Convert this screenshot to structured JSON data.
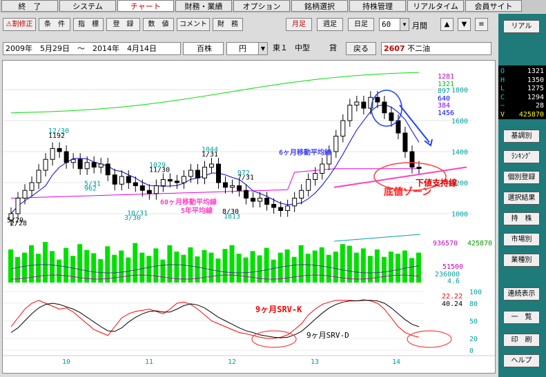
{
  "menu": {
    "tabs": [
      "終　了",
      "システム",
      "チャート",
      "財務・業績",
      "オプション",
      "銘柄選択",
      "持株管理",
      "リアルタイム",
      "会員サイト"
    ],
    "active": "チャート"
  },
  "toolbar": {
    "buttons": [
      "⚠割修正",
      "条　件",
      "指　標",
      "登　録",
      "数　値",
      "コメント",
      "財　務"
    ],
    "periods": [
      "月足",
      "週足",
      "日足"
    ],
    "count_value": "60",
    "unit_label": "月間",
    "nav_up": "▲",
    "nav_down": "▼",
    "menu_icon": "≡",
    "real_label": "リアル"
  },
  "info": {
    "date_range": "2009年　5月29日　～　2014年　4月14日",
    "unit": "百株",
    "currency": "円",
    "exchange": "東１",
    "size": "中型",
    "lend": "貸",
    "back_label": "戻る",
    "code": "2607",
    "name": "不二油"
  },
  "ohlc_panel": {
    "rows": [
      {
        "k": "O",
        "v": "1321"
      },
      {
        "k": "H",
        "v": "1350"
      },
      {
        "k": "L",
        "v": "1275"
      },
      {
        "k": "C",
        "v": "1294"
      },
      {
        "k": "−",
        "v": "28"
      },
      {
        "k": "V",
        "v": "425870"
      }
    ]
  },
  "side_buttons": [
    "基調別",
    "ﾗﾝｷﾝｸﾞ",
    "個別登録",
    "選択結果",
    "持　株",
    "市場別",
    "業種別",
    "連続表示",
    "一　覧",
    "印　刷",
    "ヘルプ"
  ],
  "chart_data": [
    {
      "type": "candlestick",
      "price_axis": [
        "1800",
        "1600",
        "1400",
        "1200",
        "1000"
      ],
      "ylim": [
        800,
        1900
      ],
      "x_labels": [
        "10",
        "11",
        "12",
        "13",
        "14"
      ],
      "legend_values": [
        {
          "text": "1281",
          "color": "#c000c0"
        },
        {
          "text": "1321",
          "color": "#00c000"
        },
        {
          "text": "897",
          "color": "#00a0a0"
        },
        {
          "text": "640",
          "color": "#0000ff"
        },
        {
          "text": "384",
          "color": "#8000ff"
        },
        {
          "text": "1456",
          "color": "#0000ff"
        }
      ],
      "closes": [
        1000,
        1100,
        1150,
        1200,
        1280,
        1350,
        1420,
        1400,
        1330,
        1350,
        1290,
        1330,
        1300,
        1320,
        1250,
        1190,
        1240,
        1200,
        1180,
        1150,
        1130,
        1180,
        1220,
        1210,
        1200,
        1240,
        1280,
        1230,
        1300,
        1320,
        1200,
        1170,
        1180,
        1150,
        1100,
        1080,
        1100,
        1060,
        1040,
        1020,
        1050,
        1100,
        1150,
        1220,
        1260,
        1320,
        1400,
        1500,
        1600,
        1700,
        1720,
        1680,
        1750,
        1720,
        1650,
        1600,
        1520,
        1400,
        1300,
        1294
      ],
      "annotations": [
        {
          "text": "12/30",
          "value": 1486
        },
        {
          "text": "1192",
          "value": 1192
        },
        {
          "text": "5/31",
          "value": 1192
        },
        {
          "text": "962",
          "value": 962
        },
        {
          "text": "5/29",
          "value": 962
        },
        {
          "text": "2/28",
          "value": 1245
        },
        {
          "text": "1029",
          "value": 1029
        },
        {
          "text": "11/30",
          "value": 1029
        },
        {
          "text": "10/31",
          "value": 1336
        },
        {
          "text": "3/30",
          "value": 1187
        },
        {
          "text": "1044",
          "value": 1044
        },
        {
          "text": "1/31",
          "value": 1044
        },
        {
          "text": "972",
          "value": 972
        },
        {
          "text": "7/31",
          "value": 972
        },
        {
          "text": "8/30",
          "value": 1813
        },
        {
          "text": "1813",
          "value": 1813
        }
      ],
      "texts": {
        "ma6": "6ヶ月移動平均線",
        "ma60": "60ヶ月移動平均線",
        "ma5y": "5年平均線",
        "support": "下値支持線",
        "bottom": "底値ゾーン"
      }
    },
    {
      "type": "bar",
      "labels": {
        "v1": "936570",
        "v2": "425870",
        "v3": "51500",
        "v4": "236000",
        "v5": "4.6"
      },
      "values": [
        620,
        480,
        560,
        700,
        540,
        760,
        590,
        430,
        650,
        500,
        720,
        610,
        550,
        440,
        680,
        520,
        600,
        470,
        740,
        560,
        500,
        640,
        430,
        700,
        580,
        520,
        660,
        490,
        610,
        560,
        450,
        630,
        700,
        540,
        470,
        590,
        510,
        650,
        430,
        560,
        620,
        480,
        700,
        540,
        600,
        660,
        520,
        580,
        720,
        690,
        560,
        640,
        500,
        620,
        480,
        580,
        540,
        600,
        460,
        560
      ]
    },
    {
      "type": "line",
      "axis_right": [
        "100",
        "80",
        "50",
        "20",
        "0"
      ],
      "ylim": [
        0,
        100
      ],
      "values_labels": {
        "k": "22.22",
        "d": "40.24"
      },
      "series": [
        {
          "name": "9ヶ月SRV-K",
          "values": [
            40,
            55,
            70,
            80,
            85,
            80,
            75,
            70,
            72,
            65,
            55,
            45,
            35,
            30,
            25,
            40,
            55,
            62,
            66,
            68,
            70,
            66,
            62,
            70,
            80,
            82,
            78,
            70,
            60,
            50,
            45,
            40,
            35,
            30,
            28,
            25,
            22,
            20,
            20,
            22,
            26,
            35,
            45,
            60,
            70,
            78,
            82,
            85,
            85,
            85,
            84,
            86,
            84,
            80,
            70,
            55,
            40,
            30,
            25,
            22
          ]
        },
        {
          "name": "9ヶ月SRV-D",
          "values": [
            30,
            38,
            50,
            62,
            72,
            78,
            80,
            78,
            74,
            70,
            64,
            56,
            48,
            40,
            33,
            32,
            38,
            48,
            56,
            62,
            66,
            67,
            65,
            65,
            70,
            76,
            79,
            77,
            72,
            64,
            56,
            50,
            44,
            38,
            33,
            30,
            26,
            24,
            22,
            21,
            22,
            26,
            32,
            42,
            53,
            63,
            72,
            78,
            82,
            84,
            84,
            85,
            85,
            84,
            80,
            72,
            62,
            52,
            44,
            40
          ]
        }
      ]
    }
  ]
}
